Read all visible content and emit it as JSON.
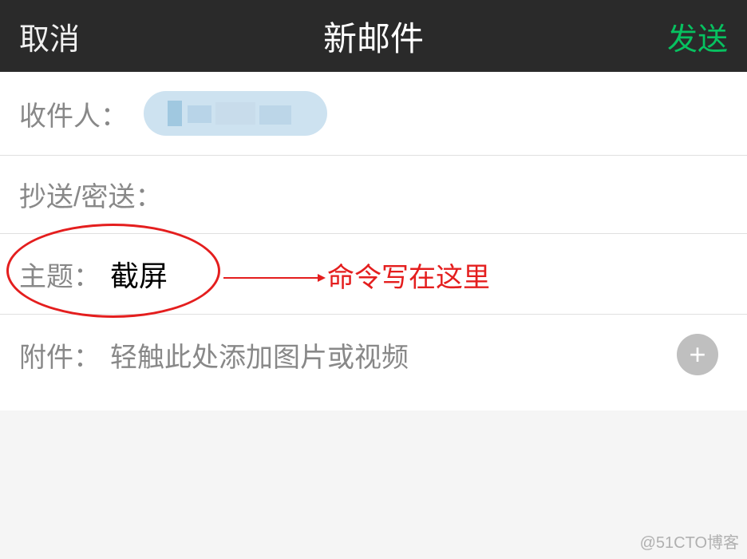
{
  "header": {
    "cancel": "取消",
    "title": "新邮件",
    "send": "发送"
  },
  "fields": {
    "recipient_label": "收件人：",
    "cc_bcc_label": "抄送/密送：",
    "subject_label": "主题：",
    "subject_value": "截屏",
    "attachment_label": "附件：",
    "attachment_placeholder": "轻触此处添加图片或视频"
  },
  "annotation": {
    "text": "命令写在这里"
  },
  "watermark": "@51CTO博客",
  "icons": {
    "plus": "+"
  }
}
